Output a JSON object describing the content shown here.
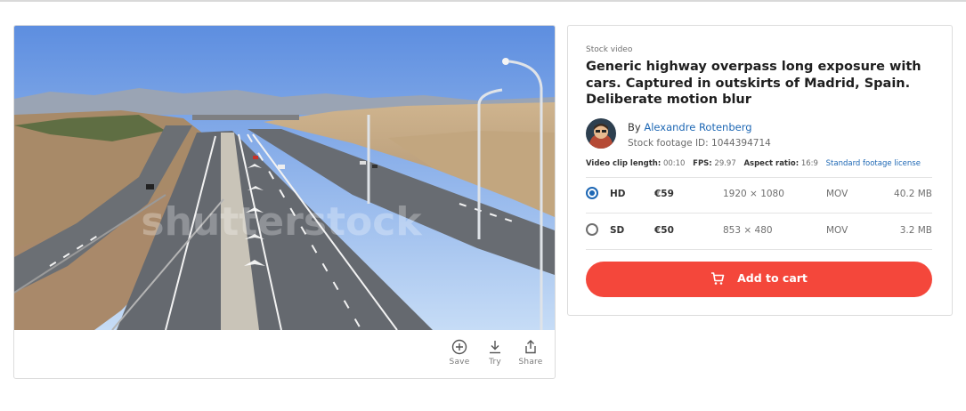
{
  "media": {
    "watermark": "shutterstock",
    "actions": [
      {
        "label": "Save",
        "icon": "plus-circle-icon"
      },
      {
        "label": "Try",
        "icon": "download-icon"
      },
      {
        "label": "Share",
        "icon": "share-icon"
      }
    ]
  },
  "details": {
    "eyebrow": "Stock video",
    "title": "Generic highway overpass long exposure with cars. Captured in outskirts of Madrid, Spain. Deliberate motion blur",
    "author_prefix": "By",
    "author_name": "Alexandre Rotenberg",
    "footage_id": "Stock footage ID: 1044394714",
    "specs": {
      "clip_length_label": "Video clip length:",
      "clip_length": "00:10",
      "fps_label": "FPS:",
      "fps": "29.97",
      "aspect_label": "Aspect ratio:",
      "aspect": "16:9",
      "license_link": "Standard footage license"
    },
    "options": [
      {
        "quality": "HD",
        "price": "€59",
        "resolution": "1920 × 1080",
        "format": "MOV",
        "size": "40.2 MB",
        "selected": true
      },
      {
        "quality": "SD",
        "price": "€50",
        "resolution": "853 × 480",
        "format": "MOV",
        "size": "3.2 MB",
        "selected": false
      }
    ],
    "cart_label": "Add to cart"
  },
  "colors": {
    "accent_button": "#f4473b",
    "link": "#1d67b4",
    "radio_selected": "#1d67b4"
  }
}
